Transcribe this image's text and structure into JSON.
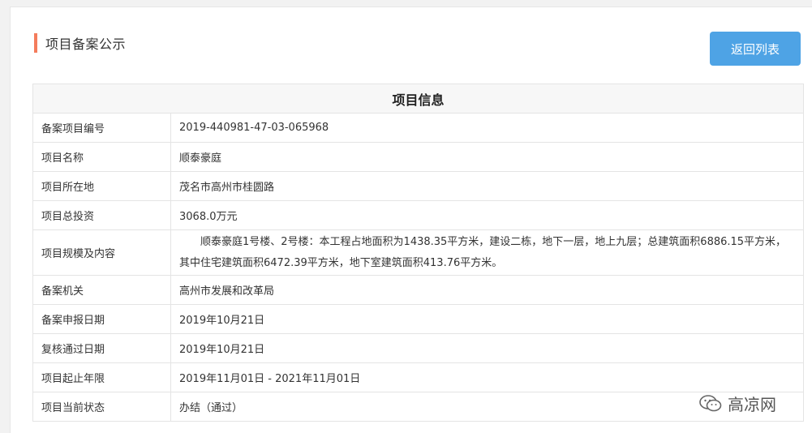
{
  "header": {
    "title": "项目备案公示",
    "back_label": "返回列表"
  },
  "table": {
    "heading": "项目信息",
    "rows": [
      {
        "label": "备案项目编号",
        "value": "2019-440981-47-03-065968"
      },
      {
        "label": "项目名称",
        "value": "顺泰豪庭"
      },
      {
        "label": "项目所在地",
        "value": "茂名市高州市桂圆路"
      },
      {
        "label": "项目总投资",
        "value": "3068.0万元"
      },
      {
        "label": "项目规模及内容",
        "value": "顺泰豪庭1号楼、2号楼：本工程占地面积为1438.35平方米，建设二栋，地下一层，地上九层；总建筑面积6886.15平方米，其中住宅建筑面积6472.39平方米，地下室建筑面积413.76平方米。"
      },
      {
        "label": "备案机关",
        "value": "高州市发展和改革局"
      },
      {
        "label": "备案申报日期",
        "value": "2019年10月21日"
      },
      {
        "label": "复核通过日期",
        "value": "2019年10月21日"
      },
      {
        "label": "项目起止年限",
        "value": "2019年11月01日 - 2021年11月01日"
      },
      {
        "label": "项目当前状态",
        "value": "办结（通过）"
      }
    ]
  },
  "watermark": {
    "text": "高凉网",
    "icon": "wechat-icon"
  },
  "colors": {
    "accent": "#f47c5c",
    "button": "#4ea3e5"
  }
}
